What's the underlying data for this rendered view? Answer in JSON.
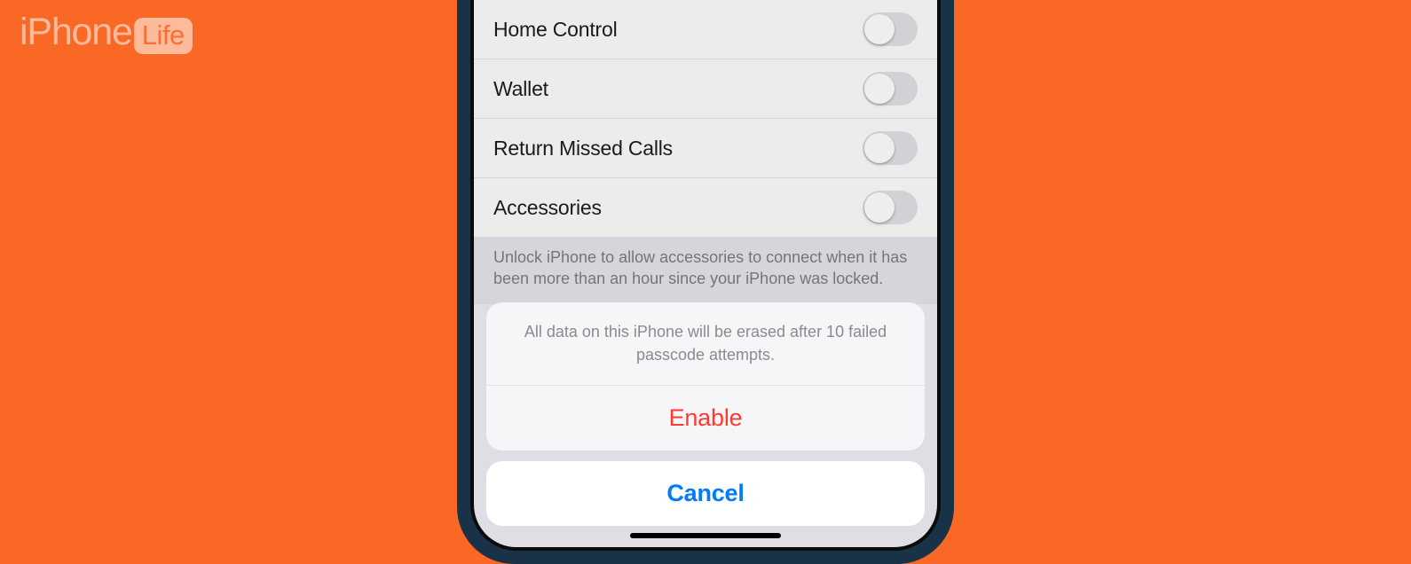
{
  "watermark": {
    "brand": "iPhone",
    "tag": "Life"
  },
  "settings": {
    "rows": [
      {
        "label": "Home Control",
        "on": false
      },
      {
        "label": "Wallet",
        "on": false
      },
      {
        "label": "Return Missed Calls",
        "on": false
      },
      {
        "label": "Accessories",
        "on": false
      }
    ],
    "footer": "Unlock iPhone to allow accessories to connect when it has been more than an hour since your iPhone was locked."
  },
  "sheet": {
    "message": "All data on this iPhone will be erased after 10 failed passcode attempts.",
    "enable": "Enable",
    "cancel": "Cancel"
  }
}
